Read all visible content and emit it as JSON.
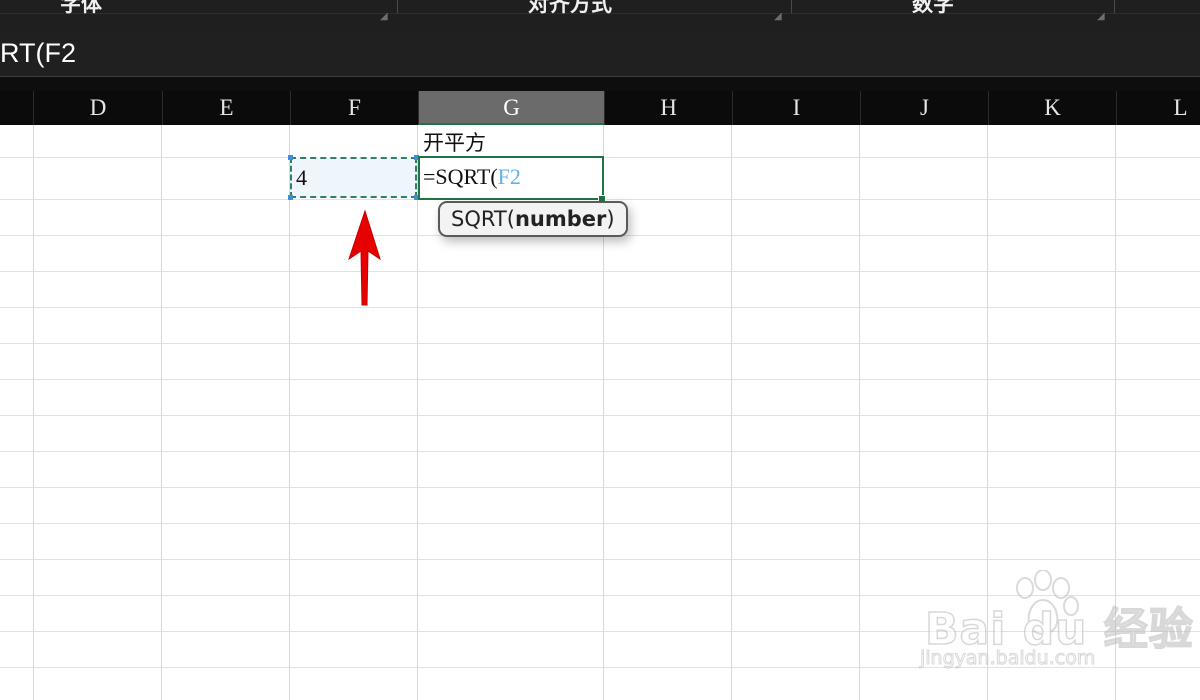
{
  "ribbon": {
    "groups": [
      {
        "label": "字体"
      },
      {
        "label": "对齐方式"
      },
      {
        "label": "数字"
      }
    ]
  },
  "formula_bar": {
    "text": "RT(F2"
  },
  "columns": [
    "D",
    "E",
    "F",
    "G",
    "H",
    "I",
    "J",
    "K",
    "L"
  ],
  "selected_column": "G",
  "cells": {
    "G1": "开平方",
    "F2": "4",
    "G2": {
      "prefix": "=SQRT(",
      "reference": "F2",
      "reference_color": "#5fb3e6"
    }
  },
  "tooltip": {
    "function": "SQRT(",
    "argument": "number",
    "close": ")"
  },
  "annotation": {
    "arrow_color": "#e60000"
  },
  "watermark": {
    "brand": "Bai du 经验",
    "site": "jingyan.baidu.com"
  },
  "colors": {
    "active_cell_border": "#217346",
    "copy_marquee": "#2f7f6a"
  }
}
